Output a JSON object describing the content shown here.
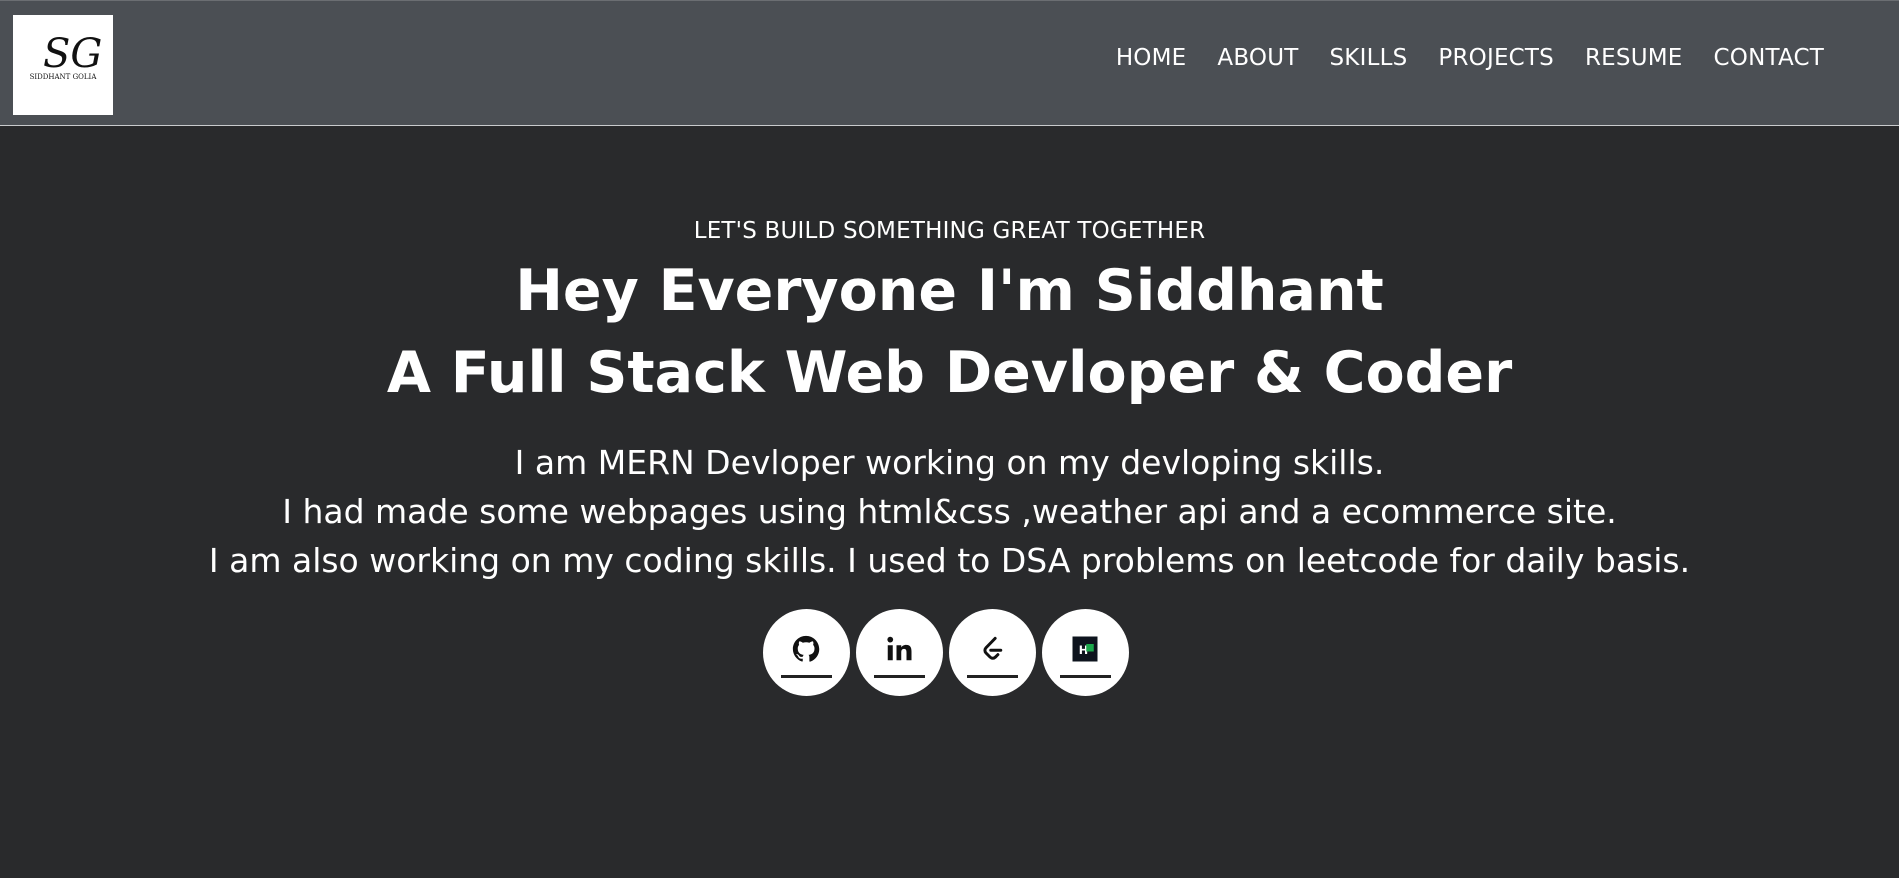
{
  "logo": {
    "initials": "SG",
    "caption": "SIDDHANT GOLIA"
  },
  "nav": {
    "items": [
      {
        "label": "HOME"
      },
      {
        "label": "ABOUT"
      },
      {
        "label": "SKILLS"
      },
      {
        "label": "PROJECTS"
      },
      {
        "label": "RESUME"
      },
      {
        "label": "CONTACT"
      }
    ]
  },
  "hero": {
    "tagline": "LET'S BUILD SOMETHING GREAT TOGETHER",
    "headline_line1": "Hey Everyone I'm Siddhant",
    "headline_line2": "A Full Stack Web Devloper & Coder",
    "intro_line1": "I am MERN Devloper working on my devloping skills.",
    "intro_line2": "I had made some webpages using html&css ,weather api and a ecommerce site.",
    "intro_line3": "I am also working on my coding skills. I used to DSA problems on leetcode for daily basis."
  },
  "socials": [
    {
      "icon": "github-icon"
    },
    {
      "icon": "linkedin-icon"
    },
    {
      "icon": "leetcode-icon"
    },
    {
      "icon": "hackerrank-icon"
    }
  ],
  "colors": {
    "page_bg": "#292a2c",
    "navbar_bg": "#4b4f54",
    "text": "#ffffff",
    "hackerrank_green": "#1ba94c"
  }
}
